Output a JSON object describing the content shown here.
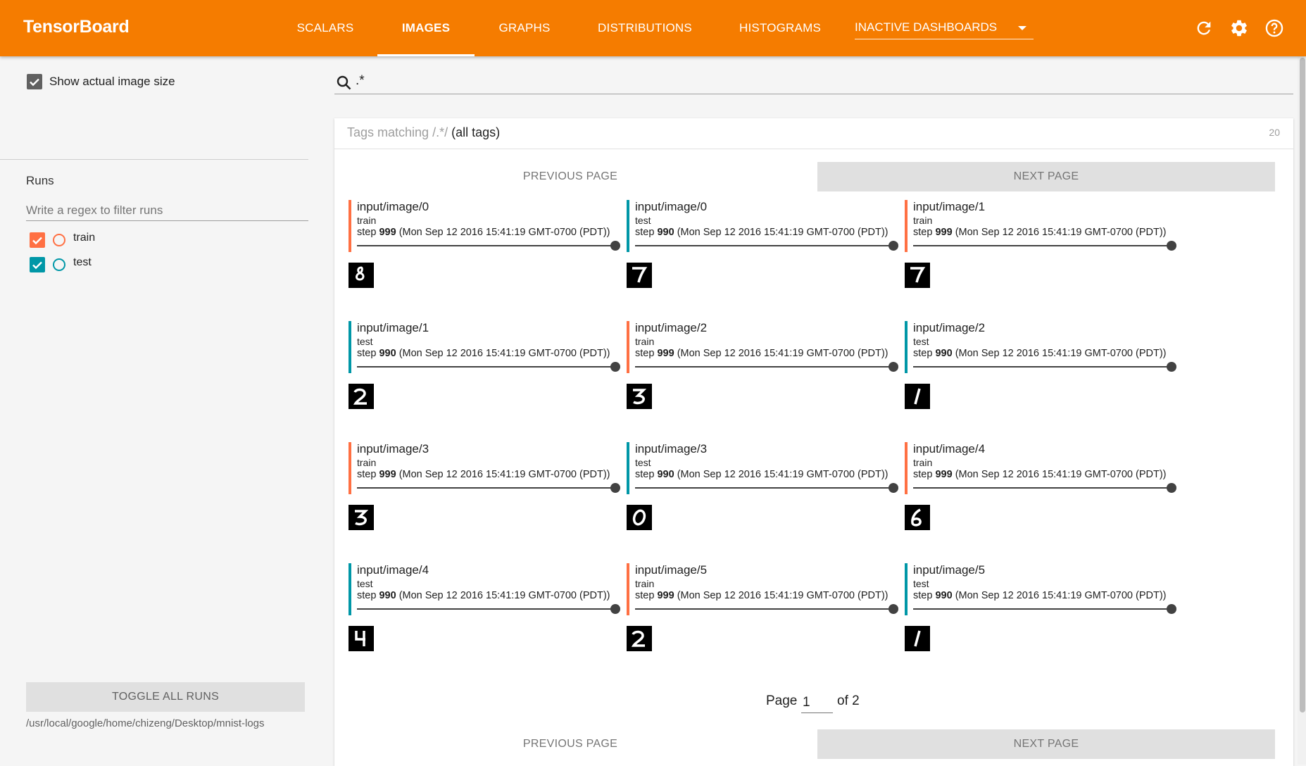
{
  "header": {
    "brand": "TensorBoard",
    "tabs": [
      {
        "label": "SCALARS"
      },
      {
        "label": "IMAGES"
      },
      {
        "label": "GRAPHS"
      },
      {
        "label": "DISTRIBUTIONS"
      },
      {
        "label": "HISTOGRAMS"
      }
    ],
    "inactive_dashboards": "INACTIVE DASHBOARDS",
    "icons": [
      "refresh-icon",
      "settings-icon",
      "help-icon"
    ],
    "colors": {
      "bar": "#f57c00",
      "text": "#ffffff"
    }
  },
  "sidebar": {
    "show_actual_size_label": "Show actual image size",
    "show_actual_size_checked": true,
    "runs_title": "Runs",
    "runs_filter_placeholder": "Write a regex to filter runs",
    "runs": [
      {
        "name": "train",
        "checked": true,
        "color": "#ff7043"
      },
      {
        "name": "test",
        "checked": true,
        "color": "#0097a7"
      }
    ],
    "toggle_all_label": "TOGGLE ALL RUNS",
    "logdir": "/usr/local/google/home/chizeng/Desktop/mnist-logs"
  },
  "main": {
    "search_value": ".*",
    "tags_prefix": "Tags matching",
    "tags_regex": "/.*/",
    "tags_suffix": "(all tags)",
    "tags_count": "20",
    "prev_label": "PREVIOUS PAGE",
    "next_label": "NEXT PAGE",
    "page_label": "Page",
    "page_current": "1",
    "page_of": "of 2",
    "tiles": [
      {
        "tag": "input/image/0",
        "run": "train",
        "step_prefix": "step",
        "step": "999",
        "time": "(Mon Sep 12 2016 15:41:19 GMT-0700 (PDT))",
        "digit": "8",
        "color": "#ff7043"
      },
      {
        "tag": "input/image/0",
        "run": "test",
        "step_prefix": "step",
        "step": "990",
        "time": "(Mon Sep 12 2016 15:41:19 GMT-0700 (PDT))",
        "digit": "7",
        "color": "#0097a7"
      },
      {
        "tag": "input/image/1",
        "run": "train",
        "step_prefix": "step",
        "step": "999",
        "time": "(Mon Sep 12 2016 15:41:19 GMT-0700 (PDT))",
        "digit": "7",
        "color": "#ff7043"
      },
      {
        "tag": "input/image/1",
        "run": "test",
        "step_prefix": "step",
        "step": "990",
        "time": "(Mon Sep 12 2016 15:41:19 GMT-0700 (PDT))",
        "digit": "2",
        "color": "#0097a7"
      },
      {
        "tag": "input/image/2",
        "run": "train",
        "step_prefix": "step",
        "step": "999",
        "time": "(Mon Sep 12 2016 15:41:19 GMT-0700 (PDT))",
        "digit": "3",
        "color": "#ff7043"
      },
      {
        "tag": "input/image/2",
        "run": "test",
        "step_prefix": "step",
        "step": "990",
        "time": "(Mon Sep 12 2016 15:41:19 GMT-0700 (PDT))",
        "digit": "1",
        "color": "#0097a7"
      },
      {
        "tag": "input/image/3",
        "run": "train",
        "step_prefix": "step",
        "step": "999",
        "time": "(Mon Sep 12 2016 15:41:19 GMT-0700 (PDT))",
        "digit": "3",
        "color": "#ff7043"
      },
      {
        "tag": "input/image/3",
        "run": "test",
        "step_prefix": "step",
        "step": "990",
        "time": "(Mon Sep 12 2016 15:41:19 GMT-0700 (PDT))",
        "digit": "0",
        "color": "#0097a7"
      },
      {
        "tag": "input/image/4",
        "run": "train",
        "step_prefix": "step",
        "step": "999",
        "time": "(Mon Sep 12 2016 15:41:19 GMT-0700 (PDT))",
        "digit": "6",
        "color": "#ff7043"
      },
      {
        "tag": "input/image/4",
        "run": "test",
        "step_prefix": "step",
        "step": "990",
        "time": "(Mon Sep 12 2016 15:41:19 GMT-0700 (PDT))",
        "digit": "4",
        "color": "#0097a7"
      },
      {
        "tag": "input/image/5",
        "run": "train",
        "step_prefix": "step",
        "step": "999",
        "time": "(Mon Sep 12 2016 15:41:19 GMT-0700 (PDT))",
        "digit": "2",
        "color": "#ff7043"
      },
      {
        "tag": "input/image/5",
        "run": "test",
        "step_prefix": "step",
        "step": "990",
        "time": "(Mon Sep 12 2016 15:41:19 GMT-0700 (PDT))",
        "digit": "1",
        "color": "#0097a7"
      }
    ]
  }
}
